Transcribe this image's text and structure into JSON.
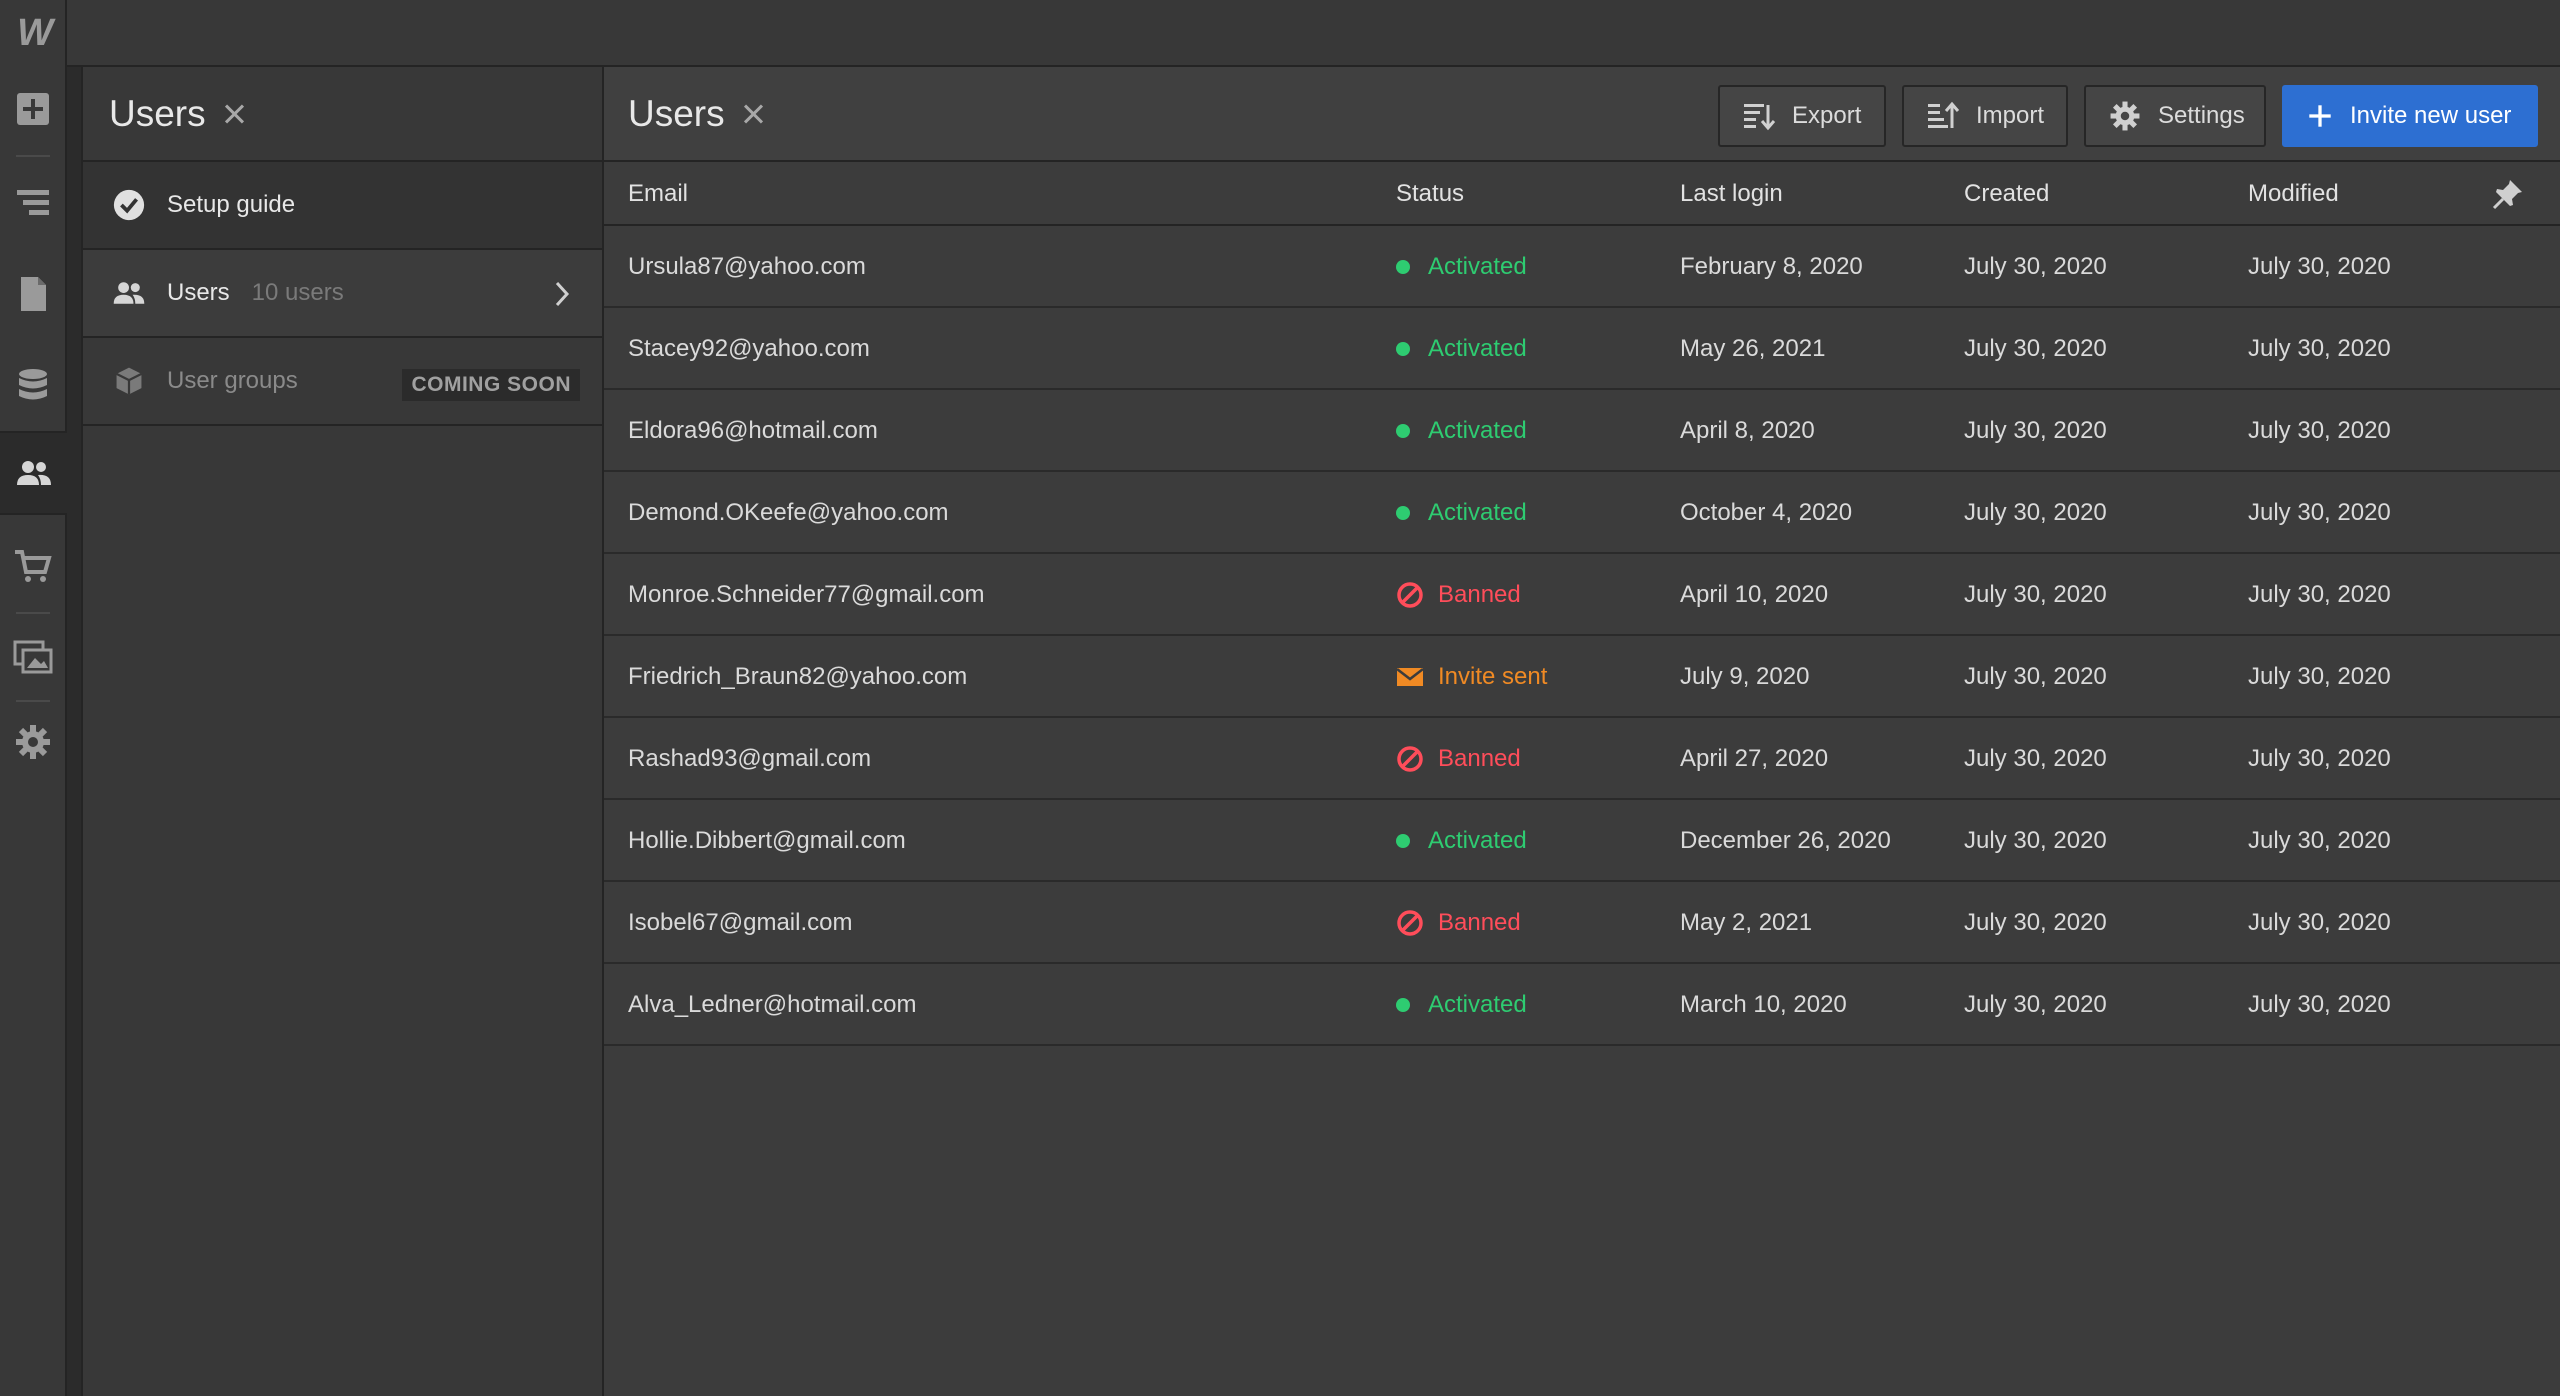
{
  "app": {
    "logo": "W"
  },
  "rail": {
    "icons": [
      "add-icon",
      "navigator-icon",
      "pages-icon",
      "cms-icon",
      "users-icon",
      "ecommerce-icon",
      "assets-icon",
      "settings-icon"
    ],
    "active": "users-icon"
  },
  "side_panel": {
    "title": "Users",
    "items": [
      {
        "label": "Setup guide",
        "icon": "check-circle-icon"
      },
      {
        "label": "Users",
        "count": "10 users",
        "icon": "users-icon"
      },
      {
        "label": "User groups",
        "badge": "COMING SOON",
        "icon": "cube-icon"
      }
    ]
  },
  "main": {
    "title": "Users",
    "toolbar": {
      "export": "Export",
      "import": "Import",
      "settings": "Settings",
      "invite": "Invite new user"
    },
    "columns": {
      "email": "Email",
      "status": "Status",
      "last_login": "Last login",
      "created": "Created",
      "modified": "Modified"
    },
    "rows": [
      {
        "email": "Ursula87@yahoo.com",
        "status": "Activated",
        "last_login": "February 8, 2020",
        "created": "July 30, 2020",
        "modified": "July 30, 2020"
      },
      {
        "email": "Stacey92@yahoo.com",
        "status": "Activated",
        "last_login": "May 26, 2021",
        "created": "July 30, 2020",
        "modified": "July 30, 2020"
      },
      {
        "email": "Eldora96@hotmail.com",
        "status": "Activated",
        "last_login": "April 8, 2020",
        "created": "July 30, 2020",
        "modified": "July 30, 2020"
      },
      {
        "email": "Demond.OKeefe@yahoo.com",
        "status": "Activated",
        "last_login": "October 4, 2020",
        "created": "July 30, 2020",
        "modified": "July 30, 2020"
      },
      {
        "email": "Monroe.Schneider77@gmail.com",
        "status": "Banned",
        "last_login": "April 10, 2020",
        "created": "July 30, 2020",
        "modified": "July 30, 2020"
      },
      {
        "email": "Friedrich_Braun82@yahoo.com",
        "status": "Invite sent",
        "last_login": "July 9, 2020",
        "created": "July 30, 2020",
        "modified": "July 30, 2020"
      },
      {
        "email": "Rashad93@gmail.com",
        "status": "Banned",
        "last_login": "April 27, 2020",
        "created": "July 30, 2020",
        "modified": "July 30, 2020"
      },
      {
        "email": "Hollie.Dibbert@gmail.com",
        "status": "Activated",
        "last_login": "December 26, 2020",
        "created": "July 30, 2020",
        "modified": "July 30, 2020"
      },
      {
        "email": "Isobel67@gmail.com",
        "status": "Banned",
        "last_login": "May 2, 2021",
        "created": "July 30, 2020",
        "modified": "July 30, 2020"
      },
      {
        "email": "Alva_Ledner@hotmail.com",
        "status": "Activated",
        "last_login": "March 10, 2020",
        "created": "July 30, 2020",
        "modified": "July 30, 2020"
      }
    ]
  },
  "colors": {
    "accent": "#2d6fd2",
    "activated": "#2ecc71",
    "banned": "#ff4d5a",
    "invite_sent": "#f08a24"
  }
}
